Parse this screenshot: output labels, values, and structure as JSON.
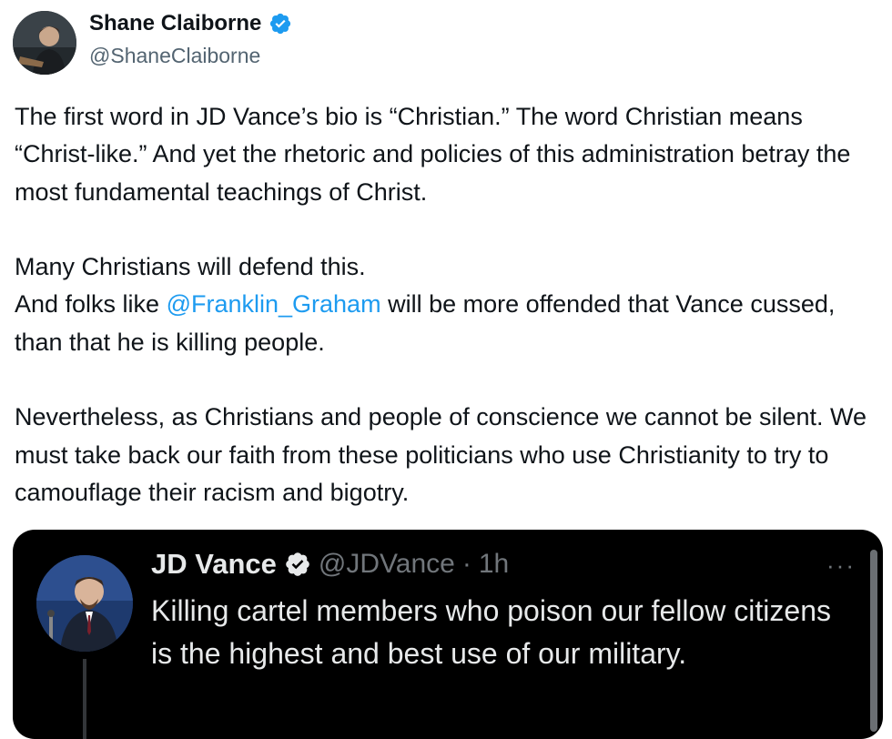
{
  "post": {
    "author_name": "Shane Claiborne",
    "author_handle": "@ShaneClaiborne",
    "paragraph1": "The first word in JD Vance’s bio is “Christian.” The word Christian means “Christ-like.” And yet the rhetoric and policies of this administration betray the most fundamental teachings of Christ.",
    "paragraph2_line1": "Many Christians will defend this.",
    "paragraph2_line2_before": "And folks like ",
    "paragraph2_mention": "@Franklin_Graham",
    "paragraph2_line2_after": " will be more offended that Vance cussed, than that he is killing people.",
    "paragraph3": "Nevertheless, as Christians and people of conscience we cannot be silent. We must take back our faith from these politicians who use Christianity to try to camouflage their racism and bigotry."
  },
  "quoted": {
    "author_name": "JD Vance",
    "author_handle": "@JDVance",
    "separator": "·",
    "time": "1h",
    "more": "···",
    "text": "Killing cartel members who poison our fellow citizens is the highest and best use of our military."
  },
  "icons": {
    "verified": "verified-badge-icon",
    "more": "more-options-icon"
  },
  "colors": {
    "verified": "#1d9bf0",
    "mention": "#1d9bf0",
    "quote_bg": "#000000"
  }
}
